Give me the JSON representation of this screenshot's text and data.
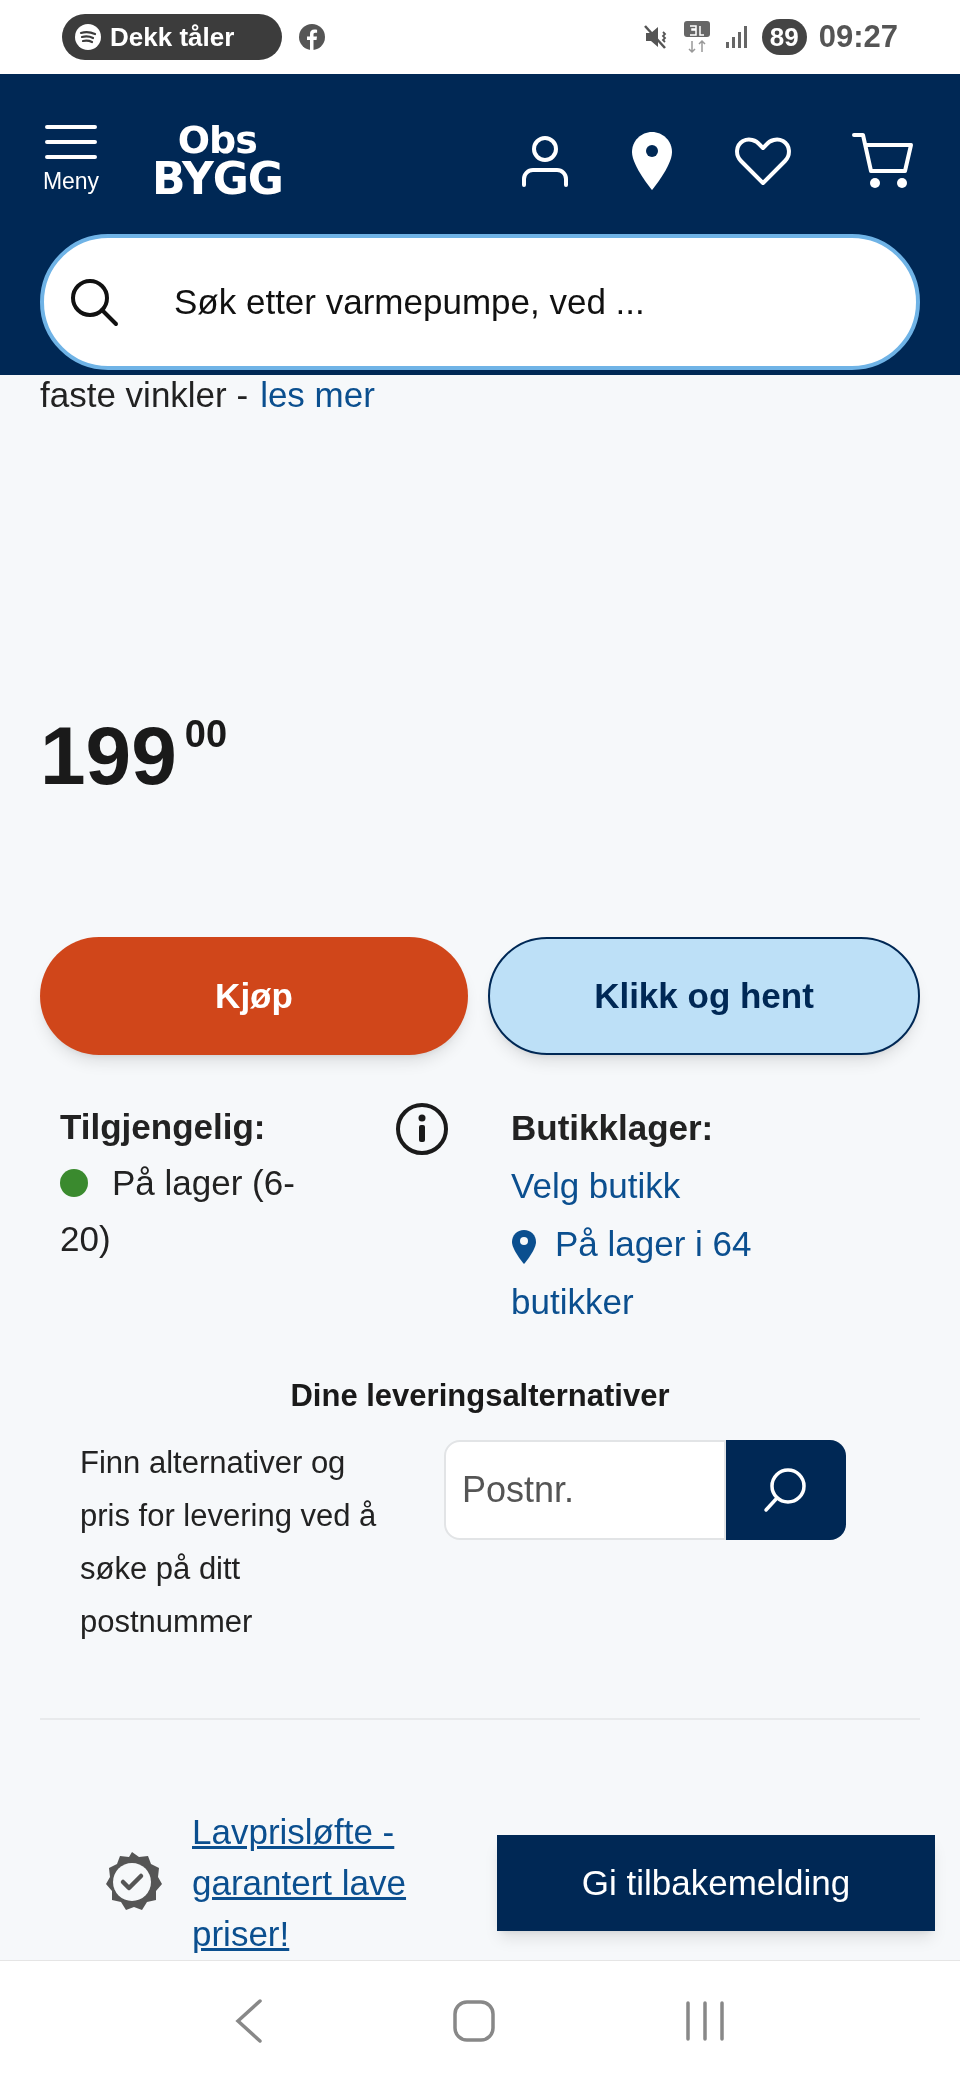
{
  "status_bar": {
    "media_chip": "Dekk tåler",
    "battery": "89",
    "time": "09:27"
  },
  "header": {
    "menu_label": "Meny",
    "logo_top": "Obs",
    "logo_bottom": "BYGG",
    "search": {
      "placeholder": "Søk etter varmepumpe, ved ..."
    }
  },
  "description": {
    "text": "faste vinkler -",
    "link": "les mer"
  },
  "price": {
    "main": "199",
    "cents": "00"
  },
  "buttons": [
    {
      "label": "Kjøp",
      "kind": "primary"
    },
    {
      "label": "Klikk og hent",
      "kind": "secondary"
    }
  ],
  "availability": {
    "title": "Tilgjengelig:",
    "status": "På lager (6-20)"
  },
  "store_stock": {
    "title": "Butikklager:",
    "choose_link": "Velg butikk",
    "stock_link": "På lager i 64 butikker"
  },
  "delivery": {
    "title": "Dine leveringsalternativer",
    "text": "Finn alternativer og pris for levering ved å søke på ditt postnummer",
    "postcode": {
      "placeholder": "Postnr."
    }
  },
  "promise": {
    "link": "Lavprisløfte - garantert lave priser!"
  },
  "feedback_button": "Gi tilbakemelding"
}
